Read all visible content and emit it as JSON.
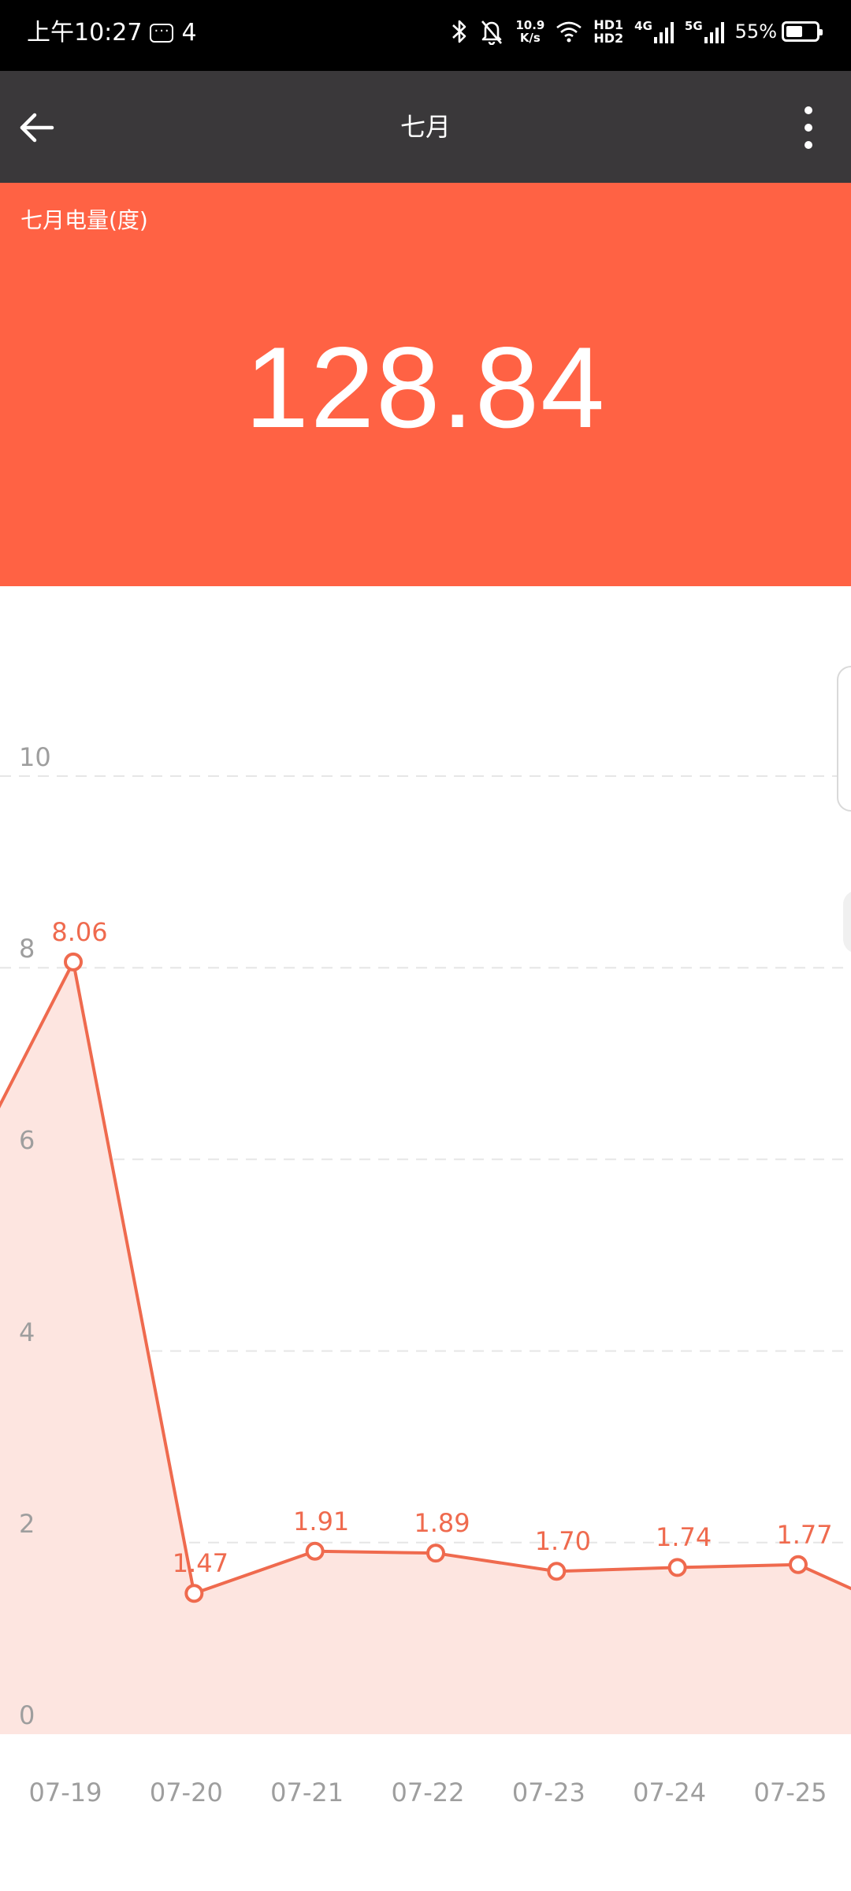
{
  "status_bar": {
    "time": "上午10:27",
    "notification_count": "4",
    "net_speed_value": "10.9",
    "net_speed_unit": "K/s",
    "hd1": "HD1",
    "hd2": "HD2",
    "net_4g": "4G",
    "net_5g": "5G",
    "battery": "55%",
    "battery_level": 0.55
  },
  "app_bar": {
    "title": "七月",
    "back_icon": "arrow-left-icon",
    "more_icon": "more-vertical-icon"
  },
  "summary": {
    "label": "七月电量(度)",
    "value": "128.84"
  },
  "colors": {
    "status_bar": "#000000",
    "app_bar": "#3a383a",
    "accent": "#ff6244",
    "line": "#ef6a4e",
    "area": "#fde5e0"
  },
  "chart_data": {
    "type": "area",
    "categories": [
      "07-19",
      "07-20",
      "07-21",
      "07-22",
      "07-23",
      "07-24",
      "07-25"
    ],
    "values": [
      8.06,
      1.47,
      1.91,
      1.89,
      1.7,
      1.74,
      1.77
    ],
    "point_labels": [
      "8.06",
      "1.47",
      "1.91",
      "1.89",
      "1.70",
      "1.74",
      "1.77"
    ],
    "ylim": [
      0,
      10
    ],
    "yticks": [
      "0",
      "2",
      "4",
      "6",
      "8",
      "10"
    ],
    "grid": true,
    "left_offscreen_value": 5.6,
    "right_offscreen_value": 1.2
  }
}
